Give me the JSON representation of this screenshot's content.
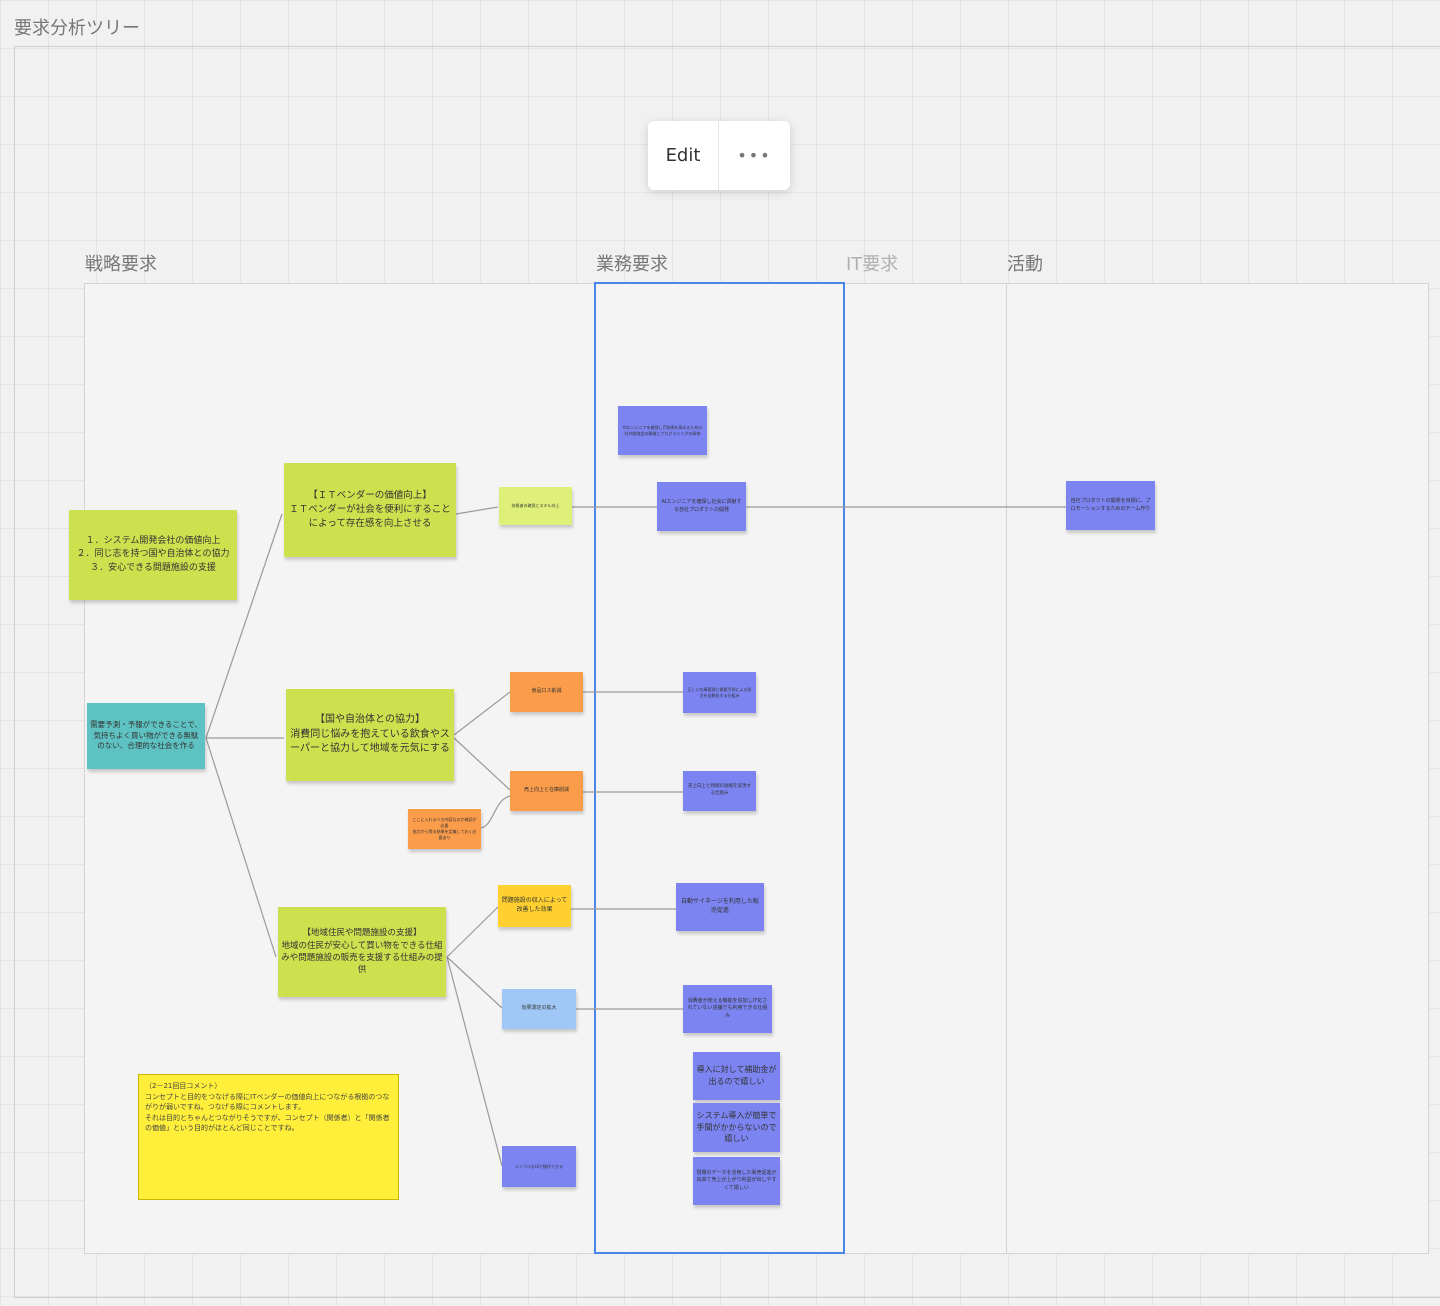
{
  "board": {
    "title": "要求分析ツリー"
  },
  "toolbar": {
    "edit_label": "Edit",
    "more_label": "•••"
  },
  "columns": {
    "strategic": "戦略要求",
    "business": "業務要求",
    "it": "IT要求",
    "activity": "活動"
  },
  "colors": {
    "yellow_green": "#cde14f",
    "light_yellow_green": "#dff07a",
    "teal": "#5ec2c2",
    "orange": "#fb9c4b",
    "yellow": "#ffd02f",
    "light_blue": "#9fc8f6",
    "blue": "#7b84f0",
    "selection": "#4a86e8",
    "note_yellow": "#ffef3a"
  },
  "stickies": {
    "goals": "１．システム開発会社の価値向上\n２．同じ志を持つ国や自治体との協力\n３．安心できる問題施設の支援",
    "root": "需要予測・予報ができることで、気持ちよく買い物ができる無駄のない、合理的な社会を作る",
    "branch_vendor": "【ＩＴベンダーの価値向上】\nＩＴベンダーが社会を便利にすることによって存在感を向上させる",
    "branch_gov": "【国や自治体との協力】\n消費同じ悩みを抱えている飲食やスーパーと協力して地域を元気にする",
    "branch_local": "【地域住民や問題施設の支援】\n地域の住民が安心して買い物をできる仕組みや問題施設の販売を支援する仕組みの提供",
    "vendor_sub": "技術者の確保とスキル向上",
    "gov_sub1": "食品ロス削減",
    "gov_sub2": "売上向上と在庫削減",
    "gov_note": "ここに入れるべき内容なのか確認が必要\n協力から得る結果を定義しておく必要あり",
    "local_sub1": "問題施設の収入によって改善した効果",
    "local_sub2": "効果測定の拡大",
    "local_sub3": "シンプルなUIで操作できる",
    "biz_1": "AIエンジニアを確保しIT技術を高めるための社内勉強会の開催とプログラミングの研修",
    "biz_2": "AIエンジニアを確保し社会に貢献する自社プロダクトの開発",
    "biz_3": "正しい在庫管理と需要予測による発注を自動化する仕組み",
    "biz_4": "売上向上と時間の短縮を実現する仕組み",
    "biz_5": "自動サイネージを利用した販売促進",
    "biz_6": "消費者が使える機能を追加しIT化されていない店舗でも利用できる仕組み",
    "biz_7": "導入に対して補助金が出るので嬉しい",
    "biz_8": "システム導入が簡単で手間がかからないので嬉しい",
    "biz_9": "現場のデータを活用した販売促進が出来て売上が上がり利益が出しやすくて嬉しい",
    "activity_1": "自社プロダクトの開発を目標に、プロモーションするためのチーム作り"
  },
  "note": "（2－21回目コメント）\nコンセプトと目的をつなげる際にITベンダーの価値向上につながる根拠のつながりが弱いですね。つなげる際にコメントします。\nそれは目的とちゃんとつながりそうですが、コンセプト（関係者）と「関係者の価値」という目的がほとんど同じことですね。"
}
